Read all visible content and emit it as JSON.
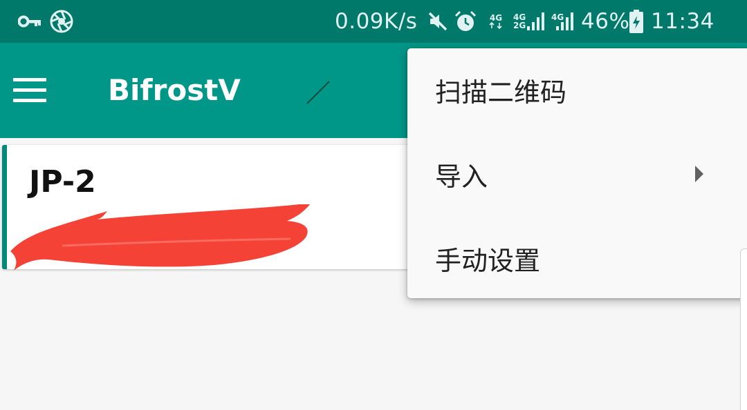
{
  "status_bar": {
    "net_speed": "0.09K/s",
    "sim1_type": "4G",
    "sim2_type_top": "4G",
    "sim2_type_bottom": "2G",
    "sim3_type": "4G",
    "battery": "46%",
    "time": "11:34",
    "icons": [
      "key-icon",
      "aperture-icon",
      "mute-icon",
      "alarm-icon",
      "signal-icon",
      "battery-charging-icon"
    ]
  },
  "toolbar": {
    "title": "BifrostV",
    "menu_icon": "hamburger-menu-icon",
    "background": "#009688"
  },
  "server_card": {
    "name": "JP-2",
    "address": "",
    "accent": "#00897b",
    "redaction_color": "#f44336"
  },
  "popup_menu": {
    "items": [
      {
        "label": "扫描二维码"
      },
      {
        "label": "导入",
        "has_submenu": true
      },
      {
        "label": "手动设置"
      }
    ]
  }
}
